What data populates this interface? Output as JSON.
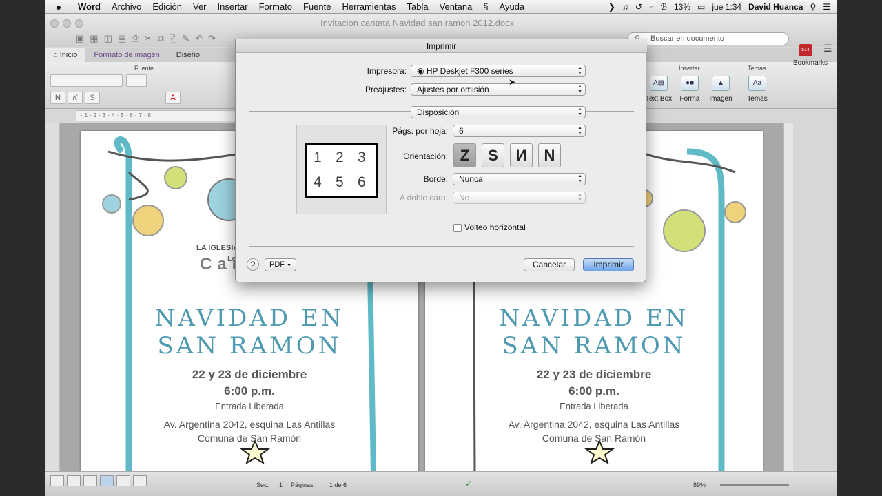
{
  "menubar": {
    "apple": "",
    "app": "Word",
    "items": [
      "Archivo",
      "Edición",
      "Ver",
      "Insertar",
      "Formato",
      "Fuente",
      "Herramientas",
      "Tabla",
      "Ventana",
      "Ayuda"
    ],
    "battery": "13%",
    "clock": "jue 1:34",
    "user": "David Huanca"
  },
  "window": {
    "title": "Invitacion cantata Navidad san ramon 2012.docx",
    "search_placeholder": "Buscar en documento",
    "zoom_field": "89%"
  },
  "ribbon": {
    "tabs": [
      "Inicio",
      "Formato de imagen",
      "Diseño"
    ],
    "groups": {
      "fuente": "Fuente",
      "insertar": "Insertar",
      "temas": "Temas"
    },
    "font_buttons": [
      "N",
      "K",
      "S"
    ],
    "buttons": {
      "textbox": "Text Box",
      "forma": "Forma",
      "imagen": "Imagen",
      "temas": "Temas"
    },
    "bookmarks": "Bookmarks",
    "badge": "514"
  },
  "ruler": "·1·2·3·4·5·6·7·8",
  "invite": {
    "church": "LA IGLESIA",
    "church_line2": "Le",
    "cantata": "Cantata",
    "title1": "NAVIDAD EN",
    "title2": "SAN RAMON",
    "dates": "22 y 23  de diciembre",
    "hour": "6:00 p.m.",
    "entrada": "Entrada Liberada",
    "address": "Av. Argentina 2042, esquina Las Antillas",
    "comuna": "Comuna de San Ramón"
  },
  "status": {
    "sec_label": "Sec.",
    "sec_value": "1",
    "pages_label": "Páginas:",
    "pages_value": "1 de 6",
    "zoom": "89%"
  },
  "dialog": {
    "title": "Imprimir",
    "printer_label": "Impresora:",
    "printer_value": "HP Deskjet F300 series",
    "presets_label": "Preajustes:",
    "presets_value": "Ajustes por omisión",
    "section_value": "Disposición",
    "pages_per_sheet_label": "Págs. por hoja:",
    "pages_per_sheet_value": "6",
    "orientation_label": "Orientación:",
    "orientation_glyphs": [
      "Z",
      "S",
      "И",
      "N"
    ],
    "border_label": "Borde:",
    "border_value": "Nunca",
    "duplex_label": "A doble cara:",
    "duplex_value": "No",
    "flip_label": "Volteo horizontal",
    "preview_numbers": [
      "1",
      "2",
      "3",
      "4",
      "5",
      "6"
    ],
    "help": "?",
    "pdf": "PDF",
    "cancel": "Cancelar",
    "print": "Imprimir"
  }
}
